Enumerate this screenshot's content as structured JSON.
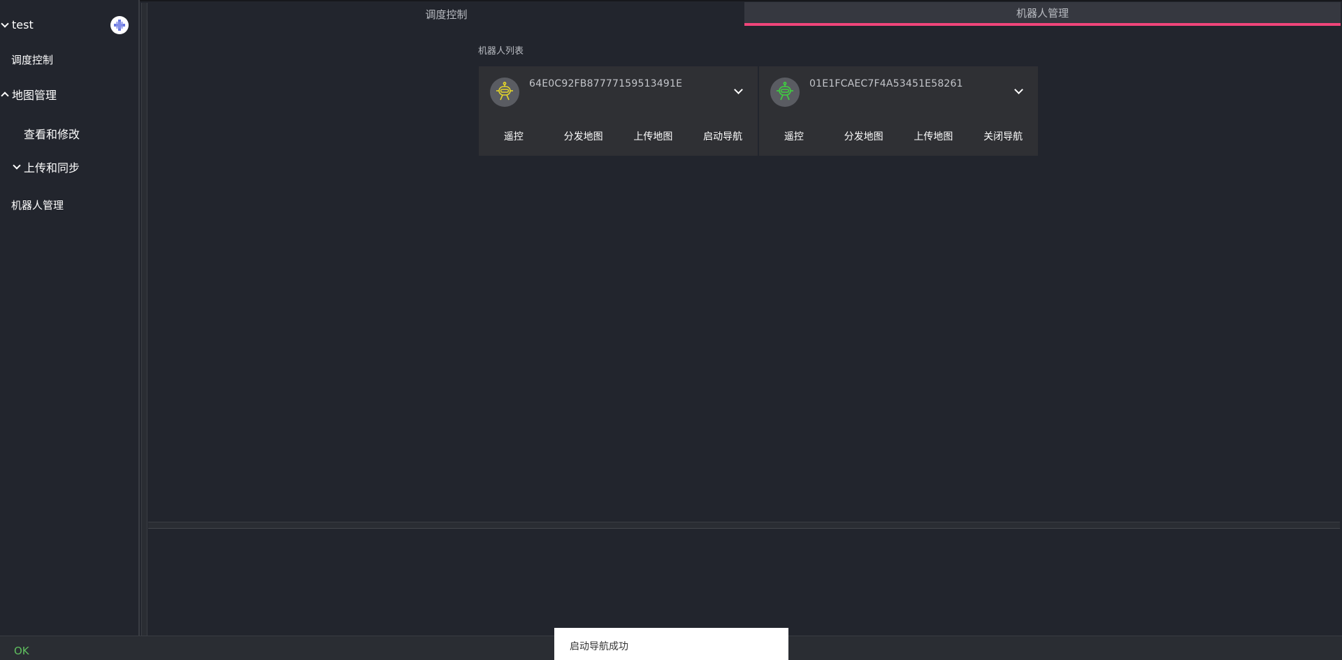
{
  "sidebar": {
    "project": "test",
    "items": [
      {
        "label": "调度控制"
      },
      {
        "label": "地图管理"
      },
      {
        "label": "查看和修改"
      },
      {
        "label": "上传和同步"
      },
      {
        "label": "机器人管理"
      }
    ],
    "add_icon": "add-robot-icon"
  },
  "tabs": [
    {
      "label": "调度控制"
    },
    {
      "label": "机器人管理"
    }
  ],
  "main": {
    "section_label": "机器人列表",
    "robots": [
      {
        "id": "64E0C92FB87777159513491E",
        "icon_color": "#e3d52a",
        "actions": [
          "遥控",
          "分发地图",
          "上传地图",
          "启动导航"
        ]
      },
      {
        "id": "01E1FCAEC7F4A53451E58261",
        "icon_color": "#3fd13f",
        "actions": [
          "遥控",
          "分发地图",
          "上传地图",
          "关闭导航"
        ]
      }
    ]
  },
  "status": {
    "text": "OK",
    "color": "#5fbf5f"
  },
  "toast": {
    "message": "启动导航成功"
  },
  "colors": {
    "tab_accent": "#f0457a",
    "background": "#22252d"
  }
}
